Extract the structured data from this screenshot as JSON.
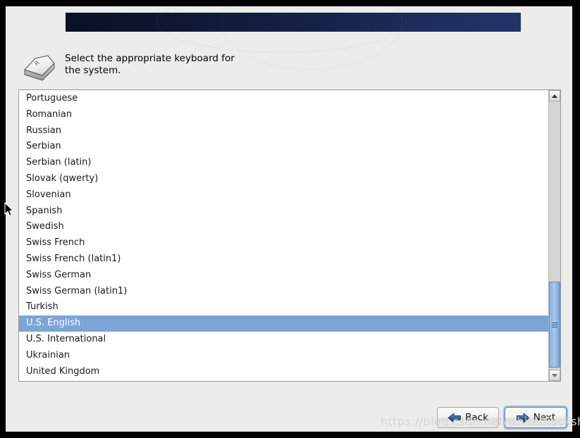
{
  "banner": {
    "accent_dark": "#0a1026",
    "accent_light": "#21356b"
  },
  "instruction": {
    "icon": "keyboard-key-icon",
    "icon_letter": "R",
    "text": "Select the appropriate keyboard for\nthe system."
  },
  "keyboard_list": {
    "selected": "U.S. English",
    "selection_color": "#7ba5d7",
    "items": [
      "Portuguese",
      "Romanian",
      "Russian",
      "Serbian",
      "Serbian (latin)",
      "Slovak (qwerty)",
      "Slovenian",
      "Spanish",
      "Swedish",
      "Swiss French",
      "Swiss French (latin1)",
      "Swiss German",
      "Swiss German (latin1)",
      "Turkish",
      "U.S. English",
      "U.S. International",
      "Ukrainian",
      "United Kingdom"
    ]
  },
  "scrollbar": {
    "up_icon": "chevron-up-icon",
    "down_icon": "chevron-down-icon",
    "thumb_color": "#8fb6e4"
  },
  "footer": {
    "back_label": "Back",
    "back_icon": "arrow-left-icon",
    "next_label": "Next",
    "next_icon": "arrow-right-icon",
    "focus_color": "#9dbde2"
  },
  "watermark": {
    "text": "https://blog.csdn.net/whiteblacksheep"
  }
}
